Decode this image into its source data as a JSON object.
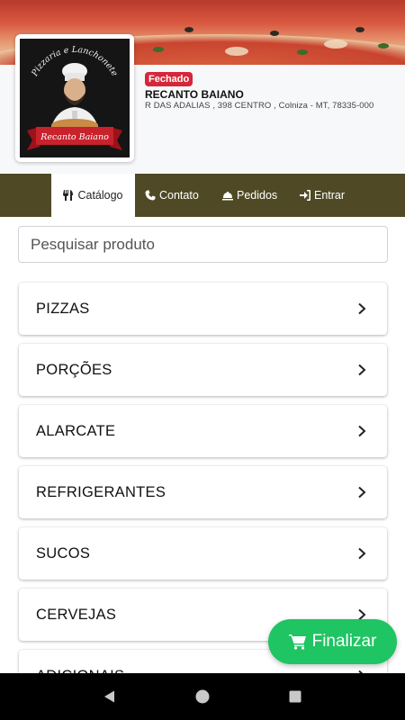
{
  "store": {
    "status": "Fechado",
    "name": "RECANTO BAIANO",
    "address": "R DAS ADALIAS , 398 CENTRO , Colniza - MT, 78335-000",
    "logo": {
      "top_text": "Pizzaria e Lanchonete",
      "ribbon_text": "Recanto Baiano"
    }
  },
  "nav": [
    {
      "label": "Catálogo",
      "icon": "utensils-icon",
      "active": true
    },
    {
      "label": "Contato",
      "icon": "phone-icon",
      "active": false
    },
    {
      "label": "Pedidos",
      "icon": "cloche-icon",
      "active": false
    },
    {
      "label": "Entrar",
      "icon": "sign-in-icon",
      "active": false
    }
  ],
  "search": {
    "placeholder": "Pesquisar produto"
  },
  "categories": [
    {
      "label": "PIZZAS"
    },
    {
      "label": "PORÇÕES"
    },
    {
      "label": "ALARCATE"
    },
    {
      "label": "REFRIGERANTES"
    },
    {
      "label": "SUCOS"
    },
    {
      "label": "CERVEJAS"
    },
    {
      "label": "ADICIONAIS"
    }
  ],
  "fab": {
    "label": "Finalizar",
    "icon": "cart-icon"
  },
  "colors": {
    "nav_bg": "#4f4a25",
    "status_badge": "#d6263a",
    "fab": "#1fc463"
  }
}
